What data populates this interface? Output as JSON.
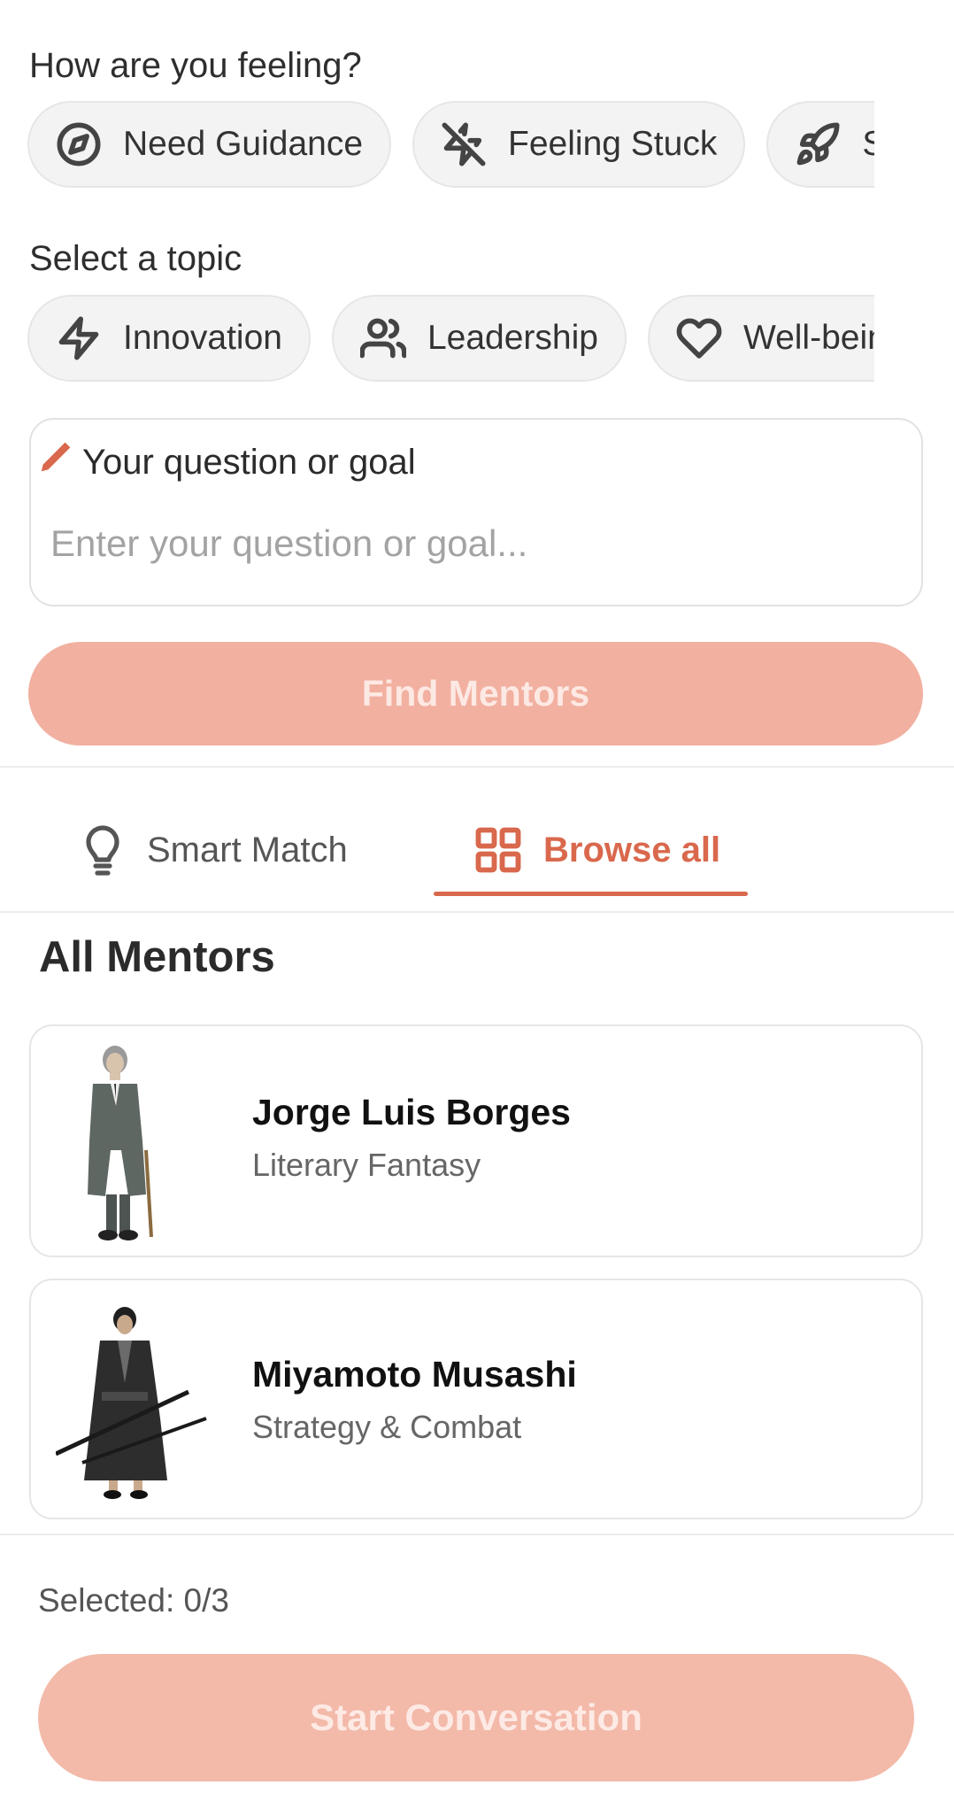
{
  "feeling": {
    "label": "How are you feeling?",
    "chips": [
      {
        "label": "Need Guidance",
        "icon": "compass-icon"
      },
      {
        "label": "Feeling Stuck",
        "icon": "zap-off-icon"
      },
      {
        "label": "Seeking Growth",
        "icon": "rocket-icon"
      }
    ]
  },
  "topic": {
    "label": "Select a topic",
    "chips": [
      {
        "label": "Innovation",
        "icon": "lightning-icon"
      },
      {
        "label": "Leadership",
        "icon": "users-icon"
      },
      {
        "label": "Well-being",
        "icon": "heart-icon"
      }
    ]
  },
  "question": {
    "title": "Your question or goal",
    "placeholder": "Enter your question or goal...",
    "value": ""
  },
  "find_button": "Find Mentors",
  "tabs": [
    {
      "label": "Smart Match",
      "icon": "lightbulb-icon",
      "active": false
    },
    {
      "label": "Browse all",
      "icon": "grid-icon",
      "active": true
    }
  ],
  "list_title": "All Mentors",
  "mentors": [
    {
      "name": "Jorge Luis Borges",
      "field": "Literary Fantasy"
    },
    {
      "name": "Miyamoto Musashi",
      "field": "Strategy & Combat"
    }
  ],
  "selection": {
    "label": "Selected: 0/3"
  },
  "start_button": "Start Conversation",
  "colors": {
    "accent": "#d9684d",
    "button_disabled": "#f2b0a0",
    "chip_bg": "#f3f3f3"
  }
}
